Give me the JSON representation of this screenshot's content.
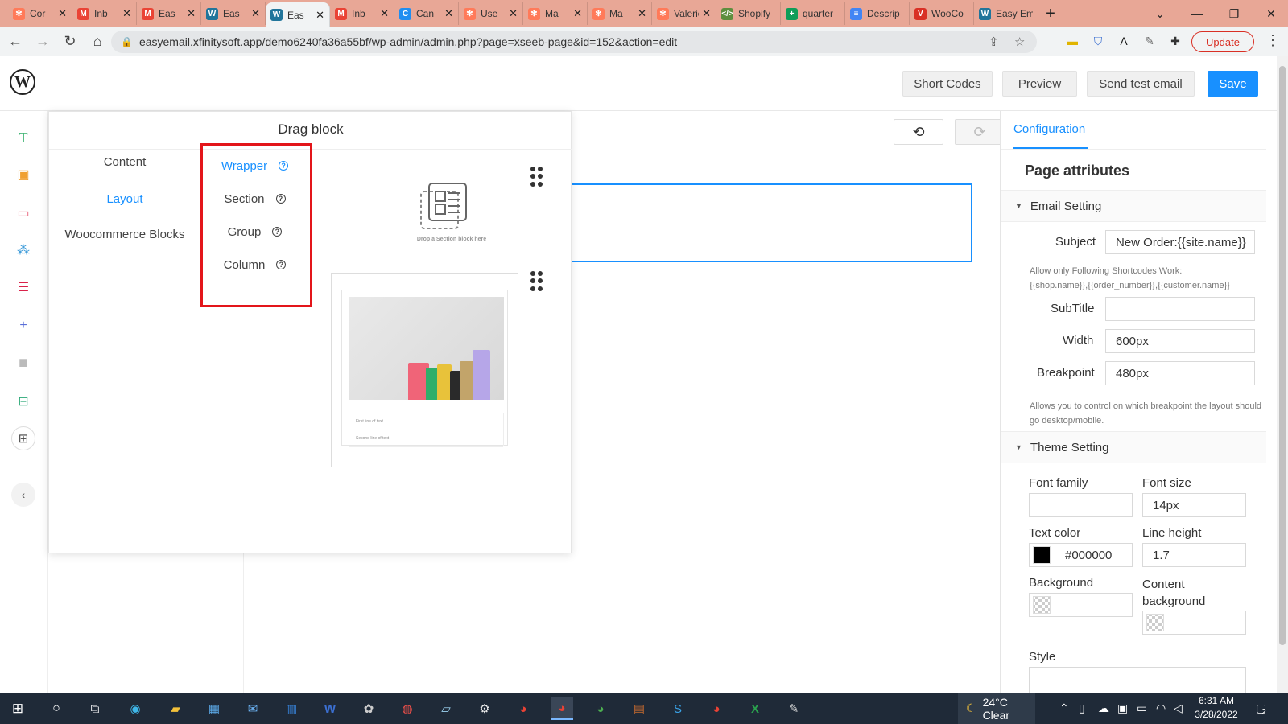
{
  "browser": {
    "tabs": [
      {
        "label": "Cor",
        "icon": "hubspot-icon",
        "color": "#ff7a59"
      },
      {
        "label": "Inb",
        "icon": "gmail-icon",
        "color": "#ea4335"
      },
      {
        "label": "Eas",
        "icon": "gmail-icon",
        "color": "#ea4335"
      },
      {
        "label": "Eas",
        "icon": "wordpress-icon",
        "color": "#21759b"
      },
      {
        "label": "Eas",
        "icon": "wordpress-icon",
        "color": "#21759b",
        "active": true
      },
      {
        "label": "Inb",
        "icon": "gmail-icon",
        "color": "#ea4335"
      },
      {
        "label": "Can",
        "icon": "canva-icon",
        "color": "#1f8ef1"
      },
      {
        "label": "Use",
        "icon": "hubspot-icon",
        "color": "#ff7a59"
      },
      {
        "label": "Ma",
        "icon": "hubspot-icon",
        "color": "#ff7a59"
      },
      {
        "label": "Ma",
        "icon": "hubspot-icon",
        "color": "#ff7a59"
      },
      {
        "label": "Valerie",
        "icon": "hubspot-icon",
        "color": "#ff7a59"
      },
      {
        "label": "Shopify",
        "icon": "shopify-icon",
        "color": "#5e8e3e"
      },
      {
        "label": "quarter",
        "icon": "sheets-icon",
        "color": "#0f9d58"
      },
      {
        "label": "Descrip",
        "icon": "docs-icon",
        "color": "#4285f4"
      },
      {
        "label": "WooCo",
        "icon": "vivaldi-icon",
        "color": "#d93025"
      },
      {
        "label": "Easy Em",
        "icon": "wordpress-icon",
        "color": "#21759b"
      }
    ],
    "url": "easyemail.xfinitysoft.app/demo6240fa36a55bf/wp-admin/admin.php?page=xseeb-page&id=152&action=edit",
    "update_label": "Update"
  },
  "header": {
    "short_codes": "Short Codes",
    "preview": "Preview",
    "send_test": "Send test email",
    "save": "Save",
    "brand_color": "#1890ff"
  },
  "drag_panel": {
    "title": "Drag block",
    "categories": [
      "Content",
      "Layout",
      "Woocommerce Blocks"
    ],
    "active_category": "Layout",
    "layout_blocks": [
      "Wrapper",
      "Section",
      "Group",
      "Column"
    ],
    "active_block": "Wrapper",
    "drop_hint": "Drop a Section block here",
    "template_rows": [
      "First line of text",
      "Second line of text"
    ]
  },
  "config": {
    "tab": "Configuration",
    "heading": "Page attributes",
    "email_setting": {
      "title": "Email Setting",
      "subject_label": "Subject",
      "subject_value": "New Order:{{site.name}}",
      "shortcode_note_1": "Allow only Following Shortcodes Work:",
      "shortcode_note_2": "{{shop.name}},{{order_number}},{{customer.name}}",
      "subtitle_label": "SubTitle",
      "subtitle_value": "",
      "width_label": "Width",
      "width_value": "600px",
      "breakpoint_label": "Breakpoint",
      "breakpoint_value": "480px",
      "breakpoint_note": "Allows you to control on which breakpoint the layout should go desktop/mobile."
    },
    "theme_setting": {
      "title": "Theme Setting",
      "font_family_label": "Font family",
      "font_family_value": "",
      "font_size_label": "Font size",
      "font_size_value": "14px",
      "text_color_label": "Text color",
      "text_color_value": "#000000",
      "line_height_label": "Line height",
      "line_height_value": "1.7",
      "background_label": "Background",
      "content_bg_label_1": "Content",
      "content_bg_label_2": "background",
      "style_label": "Style"
    }
  },
  "taskbar": {
    "weather": "24°C  Clear",
    "time": "6:31 AM",
    "date": "3/28/2022",
    "notifications": "2"
  }
}
